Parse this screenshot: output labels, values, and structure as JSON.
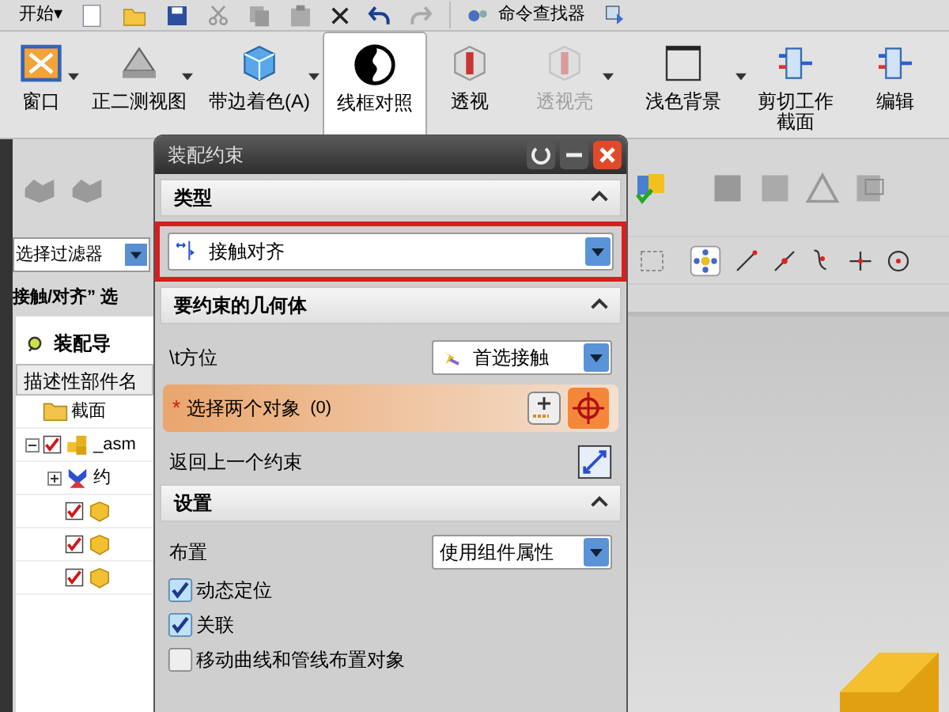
{
  "quick_access": {
    "menu": "开始",
    "menu_caret": "▾",
    "command_finder": "命令查找器"
  },
  "ribbon": [
    {
      "label": "窗口",
      "kind": "window",
      "dropdown": true,
      "disabled": false,
      "selected": false
    },
    {
      "label": "正二测视图",
      "kind": "view",
      "dropdown": true,
      "disabled": false,
      "selected": false
    },
    {
      "label": "带边着色(A)",
      "kind": "cube",
      "dropdown": true,
      "disabled": false,
      "selected": false
    },
    {
      "label": "线框对照",
      "kind": "contrast",
      "dropdown": false,
      "disabled": false,
      "selected": true
    },
    {
      "label": "透视",
      "kind": "box",
      "dropdown": false,
      "disabled": false,
      "selected": false
    },
    {
      "label": "透视壳",
      "kind": "box",
      "dropdown": true,
      "disabled": true,
      "selected": false
    },
    {
      "label": "浅色背景",
      "kind": "panel",
      "dropdown": true,
      "disabled": false,
      "selected": false
    },
    {
      "label": "剪切工作截面",
      "kind": "section",
      "dropdown": false,
      "disabled": false,
      "selected": false
    },
    {
      "label": "编辑",
      "kind": "section",
      "dropdown": false,
      "disabled": false,
      "selected": false
    }
  ],
  "left_panel": {
    "filter": "选择过滤器",
    "prompt": "接触/对齐” 选",
    "navigator_title": "装配导",
    "column": "描述性部件名",
    "tree": [
      {
        "label": "截面",
        "kind": "folder"
      },
      {
        "label": "_asm",
        "kind": "assembly",
        "checked": true,
        "expanded": true,
        "children": [
          {
            "label": "约",
            "kind": "constraints",
            "expanded": false
          },
          {
            "kind": "part",
            "checked": true
          },
          {
            "kind": "part",
            "checked": true
          },
          {
            "kind": "part",
            "checked": true
          }
        ]
      }
    ]
  },
  "dialog": {
    "title": "装配约束",
    "type_section": {
      "title": "类型",
      "expanded": true,
      "value": "接触对齐",
      "highlighted": true
    },
    "geometry_section": {
      "title": "要约束的几何体",
      "expanded": true,
      "orientation_label": "\\t方位",
      "orientation_value": "首选接触",
      "required_mark": "*",
      "select_label": "选择两个对象",
      "select_count": "(0)",
      "back_label": "返回上一个约束"
    },
    "settings_section": {
      "title": "设置",
      "expanded": true,
      "arrangement_label": "布置",
      "arrangement_value": "使用组件属性",
      "options": [
        {
          "label": "动态定位",
          "checked": true
        },
        {
          "label": "关联",
          "checked": true
        },
        {
          "label": "移动曲线和管线布置对象",
          "checked": false
        }
      ]
    }
  }
}
